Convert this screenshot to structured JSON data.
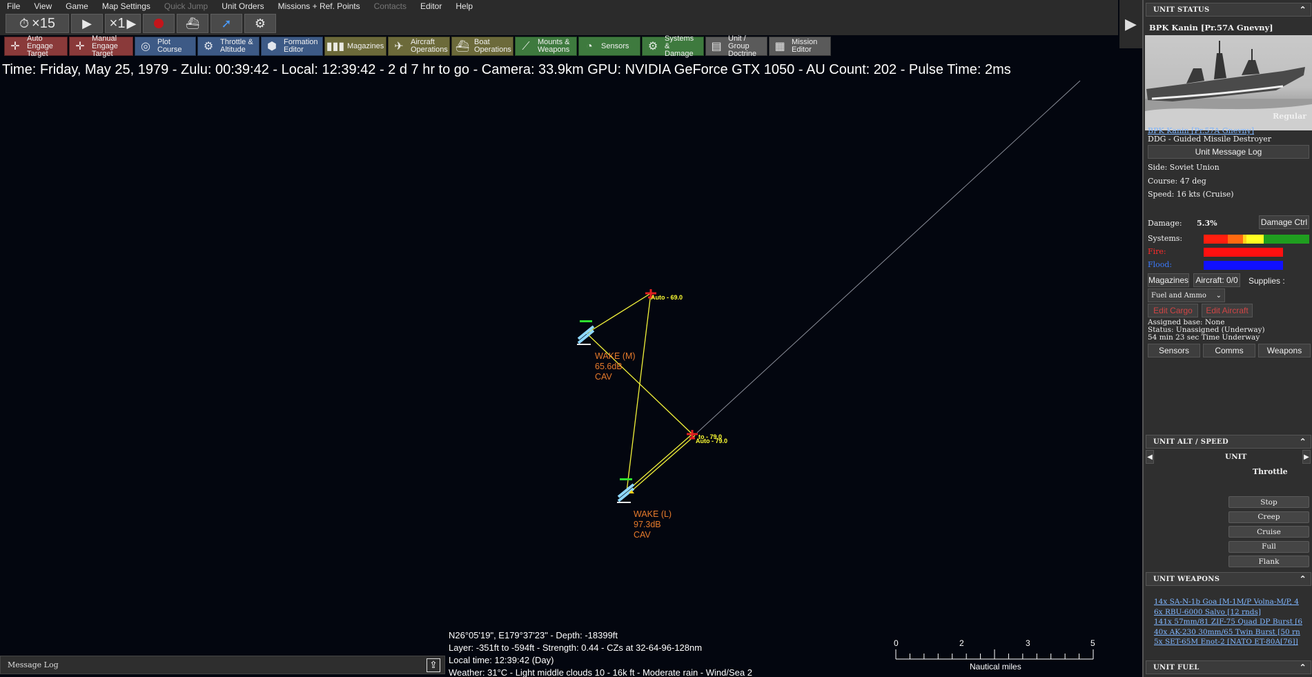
{
  "menu": {
    "items": [
      {
        "label": "File",
        "enabled": true
      },
      {
        "label": "View",
        "enabled": true
      },
      {
        "label": "Game",
        "enabled": true
      },
      {
        "label": "Map Settings",
        "enabled": true
      },
      {
        "label": "Quick Jump",
        "enabled": false
      },
      {
        "label": "Unit Orders",
        "enabled": true
      },
      {
        "label": "Missions + Ref. Points",
        "enabled": true
      },
      {
        "label": "Contacts",
        "enabled": false
      },
      {
        "label": "Editor",
        "enabled": true
      },
      {
        "label": "Help",
        "enabled": true
      }
    ]
  },
  "sim": {
    "time_compression": "×15",
    "step": "×1"
  },
  "toolbar": [
    {
      "label": "Auto Engage\nTarget",
      "color": "#8a3a3a",
      "icon": "crosshair-icon",
      "glyph": "✛"
    },
    {
      "label": "Manual\nEngage Target",
      "color": "#8a3a3a",
      "icon": "crosshair-icon",
      "glyph": "✛"
    },
    {
      "label": "Plot Course",
      "color": "#3d5a86",
      "icon": "compass-icon",
      "glyph": "◎"
    },
    {
      "label": "Throttle &\nAltitude",
      "color": "#3d5a86",
      "icon": "throttle-icon",
      "glyph": "⚙"
    },
    {
      "label": "Formation\nEditor",
      "color": "#3d5a86",
      "icon": "formation-icon",
      "glyph": "⬢"
    },
    {
      "label": "Magazines",
      "color": "#6c6a3a",
      "icon": "magazine-icon",
      "glyph": "▮▮▮"
    },
    {
      "label": "Aircraft\nOperations",
      "color": "#6c6a3a",
      "icon": "aircraft-icon",
      "glyph": "✈"
    },
    {
      "label": "Boat\nOperations",
      "color": "#6c6a3a",
      "icon": "boat-icon",
      "glyph": "⛴"
    },
    {
      "label": "Mounts &\nWeapons",
      "color": "#3e7a3e",
      "icon": "weapons-icon",
      "glyph": "⟋"
    },
    {
      "label": "Sensors",
      "color": "#3e7a3e",
      "icon": "sensor-icon",
      "glyph": "◔"
    },
    {
      "label": "Systems &\nDamage",
      "color": "#3e7a3e",
      "icon": "gear-icon",
      "glyph": "⚙"
    },
    {
      "label": "Unit / Group\nDoctrine",
      "color": "#5a5a5a",
      "icon": "document-icon",
      "glyph": "▤"
    },
    {
      "label": "Mission\nEditor",
      "color": "#5a5a5a",
      "icon": "mission-icon",
      "glyph": "▦"
    }
  ],
  "status_line": "Time: Friday, May 25, 1979 - Zulu: 00:39:42 - Local: 12:39:42 - 2 d 7 hr to go - Camera: 33.9km GPU: NVIDIA GeForce GTX 1050 - AU Count: 202 - Pulse Time: 2ms",
  "map": {
    "units": [
      {
        "name": "WAKE (M)",
        "level": "65.6dB",
        "type": "CAV"
      },
      {
        "name": "WAKE (L)",
        "level": "97.3dB",
        "type": "CAV"
      }
    ],
    "waypoints": [
      {
        "label": "Auto - 69.0"
      },
      {
        "label": "to - 79.0"
      },
      {
        "label": "Auto - 79.0"
      }
    ]
  },
  "cursor_info": {
    "line1": "N26°05'19\", E179°37'23\" - Depth: -18399ft",
    "line2": "Layer: -351ft to -594ft - Strength: 0.44 - CZs at 32-64-96-128nm",
    "line3": "Local time: 12:39:42 (Day)",
    "line4": "Weather: 31°C - Light middle clouds 10 - 16k ft - Moderate rain - Wind/Sea 2"
  },
  "scale": {
    "ticks": [
      "0",
      "2",
      "3",
      "5"
    ],
    "units": "Nautical miles"
  },
  "message_log": {
    "label": "Message Log"
  },
  "panel": {
    "unit_status": {
      "header": "UNIT STATUS",
      "title": "BPK Kanin [Pr.57A Gnevny]",
      "proficiency": "Regular",
      "class_link": "BPK Kanin [Pr.57A Gnevny]",
      "type": "DDG - Guided Missile Destroyer",
      "message_log_btn": "Unit Message Log",
      "side": "Side: Soviet Union",
      "course": "Course: 47 deg",
      "speed": "Speed: 16 kts (Cruise)",
      "damage_label": "Damage:",
      "damage_value": "5.3%",
      "damage_ctrl_btn": "Damage Ctrl",
      "systems_label": "Systems:",
      "fire_label": "Fire:",
      "flood_label": "Flood:",
      "magazines_btn": "Magazines",
      "aircraft_btn": "Aircraft: 0/0",
      "supplies_label": "Supplies :",
      "supplies_select": "Fuel and Ammo",
      "edit_cargo_btn": "Edit Cargo",
      "edit_aircraft_btn": "Edit Aircraft",
      "assigned_base": "Assigned base: None",
      "status": "Status: Unassigned (Underway)",
      "time_underway": "54 min 23 sec Time Underway",
      "sensors_btn": "Sensors",
      "comms_btn": "Comms",
      "weapons_btn": "Weapons"
    },
    "alt_speed": {
      "header": "UNIT ALT / SPEED",
      "unit_label": "UNIT",
      "throttle_label": "Throttle",
      "speeds": [
        "Stop",
        "Creep",
        "Cruise",
        "Full",
        "Flank"
      ]
    },
    "weapons": {
      "header": "UNIT WEAPONS",
      "items": [
        "14x SA-N-1b Goa [M-1M/P Volna-M/P, 4",
        "6x RBU-6000 Salvo [12 rnds]",
        "141x 57mm/81 ZIF-75 Quad DP Burst [6",
        "40x AK-230 30mm/65 Twin Burst [50 rn",
        "5x SET-65M Enot-2 [NATO ET-80A[76]]"
      ]
    },
    "fuel": {
      "header": "UNIT FUEL"
    },
    "colors": {
      "fire": "#ff1010",
      "flood": "#1010ff",
      "systems": [
        "#ff1e0e",
        "#ff6a10",
        "#ffd21a",
        "#ffff22",
        "#1f9e1f"
      ]
    }
  }
}
